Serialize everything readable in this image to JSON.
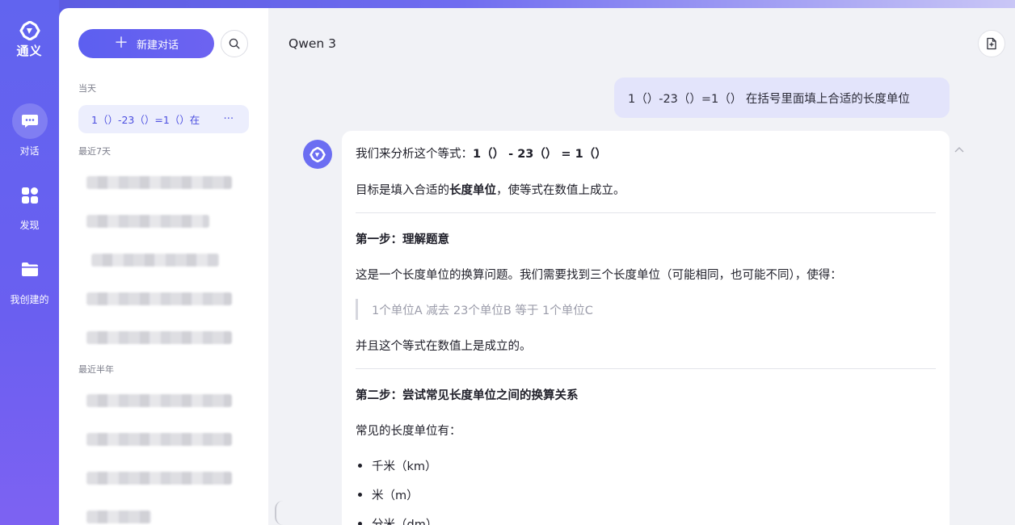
{
  "app": {
    "logo_text": "通义"
  },
  "rail": {
    "items": [
      {
        "label": "对话",
        "icon": "chat-icon",
        "active": true
      },
      {
        "label": "发现",
        "icon": "grid-icon",
        "active": false
      },
      {
        "label": "我创建的",
        "icon": "folder-icon",
        "active": false
      }
    ]
  },
  "sidebar": {
    "new_chat_label": "新建对话",
    "sections": {
      "today": "当天",
      "last7": "最近7天",
      "halfyear": "最近半年"
    },
    "active_conversation": {
      "title": "1（）-23（）=1（）在",
      "more": "⋯"
    }
  },
  "main": {
    "model_title": "Qwen 3",
    "user_message": "1（）-23（）=1（） 在括号里面填上合适的长度单位",
    "answer": {
      "intro_prefix": "我们来分析这个等式：",
      "intro_bold": "1（） - 23（） = 1（）",
      "goal_1": "目标是填入合适的",
      "goal_bold": "长度单位",
      "goal_2": "，使等式在数值上成立。",
      "step1_title": "第一步：理解题意",
      "step1_text": "这是一个长度单位的换算问题。我们需要找到三个长度单位（可能相同，也可能不同），使得：",
      "quote": "1个单位A 减去 23个单位B 等于 1个单位C",
      "step1_end": "并且这个等式在数值上是成立的。",
      "step2_title": "第二步：尝试常见长度单位之间的换算关系",
      "units_intro": "常见的长度单位有：",
      "units": [
        "千米（km）",
        "米（m）",
        "分米（dm）"
      ]
    }
  },
  "colors": {
    "accent": "#5c5ff0",
    "rail": "#6164ef",
    "bubble": "#e3e4fb"
  }
}
